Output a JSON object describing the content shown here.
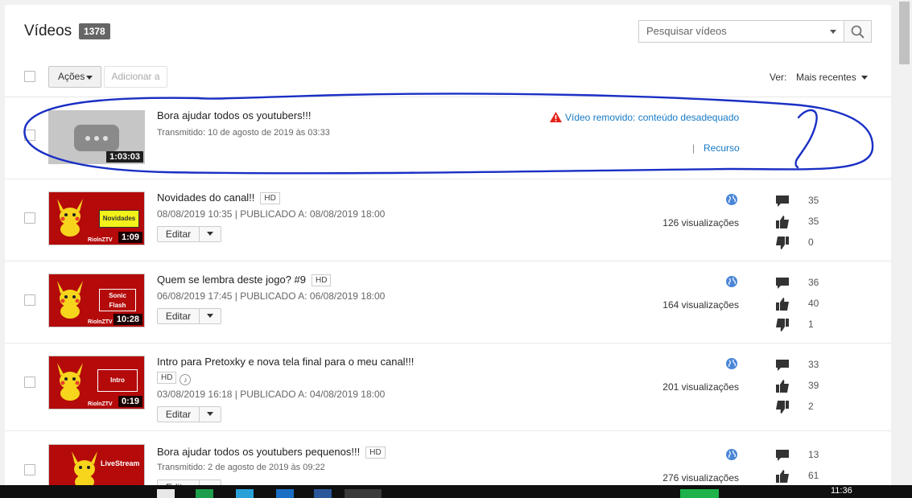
{
  "header": {
    "title": "Vídeos",
    "count": "1378",
    "search_placeholder": "Pesquisar vídeos"
  },
  "toolbar": {
    "actions_label": "Ações",
    "add_label": "Adicionar a",
    "view_label": "Ver:",
    "view_selected": "Mais recentes"
  },
  "removed_video": {
    "title": "Bora ajudar todos os youtubers!!!",
    "meta": "Transmitido: 10 de agosto de 2019 às 03:33",
    "duration": "1:03:03",
    "status": "Vídeo removido: conteúdo desadequado",
    "separator": "|",
    "resource_link": "Recurso"
  },
  "videos": [
    {
      "title": "Novidades do canal!!",
      "hd": "HD",
      "meta": "08/08/2019 10:35 | PUBLICADO A: 08/08/2019 18:00",
      "duration": "1:09",
      "thumb_label": "Novidades",
      "thumb_footer": "RiolnZTV",
      "edit": "Editar",
      "views": "126 visualizações",
      "comments": "35",
      "likes": "35",
      "dislikes": "0"
    },
    {
      "title": "Quem se lembra deste jogo? #9",
      "hd": "HD",
      "meta": "06/08/2019 17:45 | PUBLICADO A: 06/08/2019 18:00",
      "duration": "10:28",
      "thumb_label": "Sonic Flash",
      "thumb_footer": "RiolnZTV",
      "edit": "Editar",
      "views": "164 visualizações",
      "comments": "36",
      "likes": "40",
      "dislikes": "1"
    },
    {
      "title": "Intro para Pretoxky e nova tela final para o meu canal!!!",
      "hd": "HD",
      "meta": "03/08/2019 16:18 | PUBLICADO A: 04/08/2019 18:00",
      "duration": "0:19",
      "thumb_label": "Intro",
      "thumb_footer": "RiolnZTV",
      "edit": "Editar",
      "views": "201 visualizações",
      "comments": "33",
      "likes": "39",
      "dislikes": "2"
    },
    {
      "title": "Bora ajudar todos os youtubers pequenos!!!",
      "hd": "HD",
      "meta": "Transmitido: 2 de agosto de 2019 às 09:22",
      "thumb_label": "LiveStream",
      "edit": "Editar",
      "views": "276 visualizações",
      "comments": "13",
      "likes": "61"
    }
  ],
  "taskbar": {
    "time": "11:36"
  },
  "colors": {
    "link_blue": "#167ac6",
    "warning_red": "#e62117",
    "annotation_blue": "#1a2fc4",
    "thumb_red": "#b40a0a",
    "globe_blue": "#4a86d8"
  },
  "icons": [
    "search-icon",
    "globe-icon",
    "comment-icon",
    "thumbs-up-icon",
    "thumbs-down-icon",
    "warning-icon",
    "music-icon"
  ]
}
